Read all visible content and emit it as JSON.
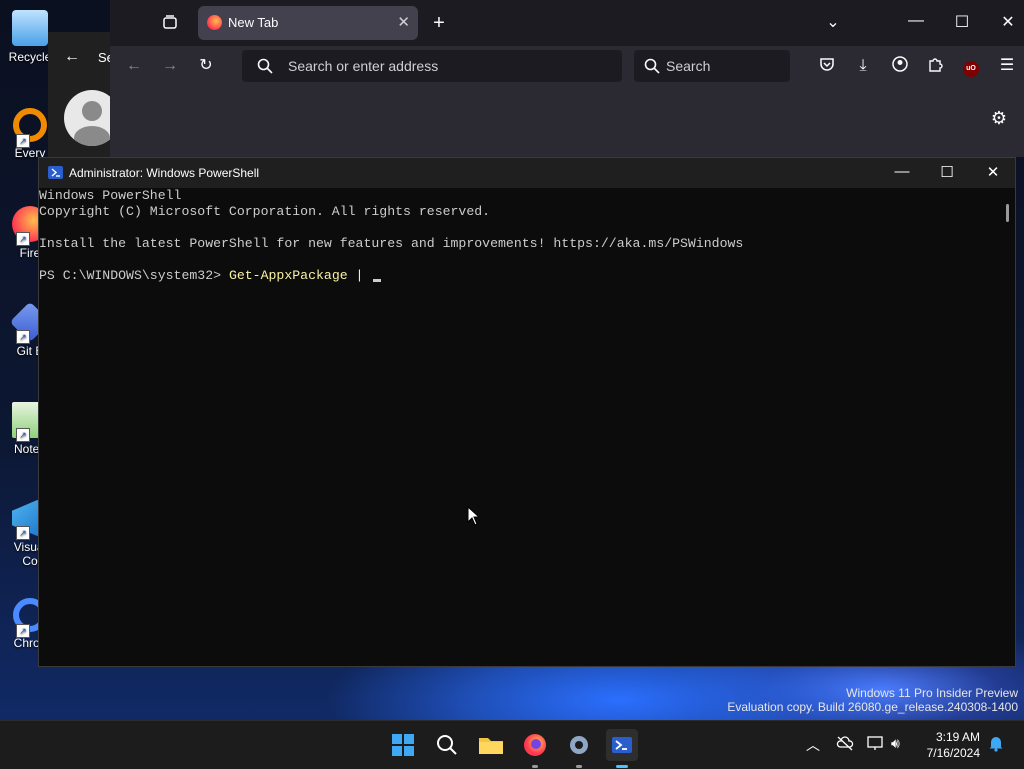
{
  "desktop": {
    "icons": [
      {
        "label": "Recycle"
      },
      {
        "label": "Every"
      },
      {
        "label": "Fire"
      },
      {
        "label": "Git B"
      },
      {
        "label": "Notep"
      },
      {
        "label": "Visual"
      },
      {
        "label": "Co"
      },
      {
        "label": "Chron"
      }
    ]
  },
  "browser": {
    "tab_title": "New Tab",
    "url_placeholder": "Search or enter address",
    "search_placeholder": "Search",
    "extension_badge": "uO"
  },
  "settings_window": {
    "title_partial": "Se"
  },
  "powershell": {
    "title": "Administrator: Windows PowerShell",
    "lines": [
      "Windows PowerShell",
      "Copyright (C) Microsoft Corporation. All rights reserved.",
      "",
      "Install the latest PowerShell for new features and improvements! https://aka.ms/PSWindows",
      ""
    ],
    "prompt": "PS C:\\WINDOWS\\system32> ",
    "command": "Get-AppxPackage | "
  },
  "watermark": {
    "line1": "Windows 11 Pro Insider Preview",
    "line2": "Evaluation copy. Build 26080.ge_release.240308-1400"
  },
  "taskbar": {
    "time": "3:19 AM",
    "date": "7/16/2024"
  }
}
